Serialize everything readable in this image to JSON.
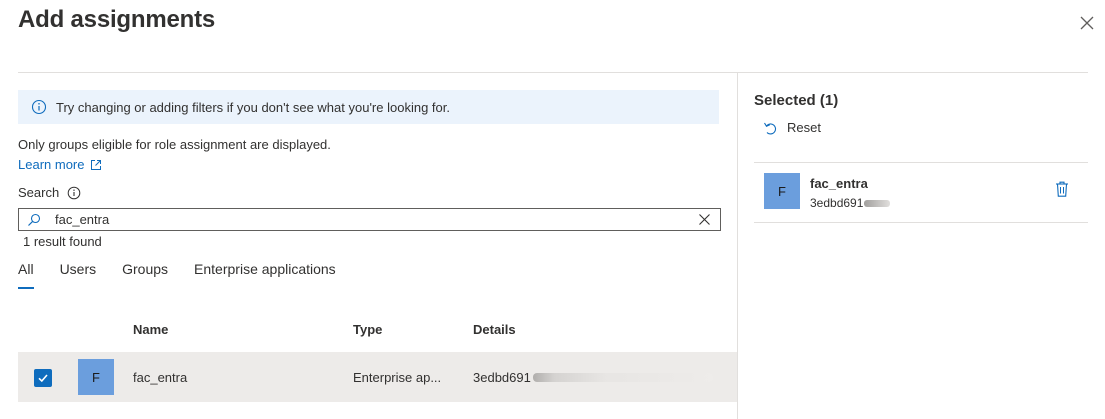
{
  "dialog": {
    "title": "Add assignments",
    "close_icon": "close-icon"
  },
  "info_bar": {
    "icon": "info-icon",
    "text": "Try changing or adding filters if you don't see what you're looking for."
  },
  "eligibility_note": "Only groups eligible for role assignment are displayed.",
  "learn_more": {
    "label": "Learn more",
    "icon": "external-link-icon"
  },
  "search": {
    "label": "Search",
    "value": "fac_entra",
    "placeholder": "",
    "result_count": "1 result found"
  },
  "tabs": [
    {
      "label": "All",
      "active": true
    },
    {
      "label": "Users",
      "active": false
    },
    {
      "label": "Groups",
      "active": false
    },
    {
      "label": "Enterprise applications",
      "active": false
    }
  ],
  "table": {
    "columns": {
      "name": "Name",
      "type": "Type",
      "details": "Details"
    },
    "rows": [
      {
        "checked": true,
        "avatar": "F",
        "name": "fac_entra",
        "type": "Enterprise ap...",
        "details": "3edbd691"
      }
    ]
  },
  "selected": {
    "title": "Selected (1)",
    "reset_label": "Reset",
    "items": [
      {
        "avatar": "F",
        "name": "fac_entra",
        "id": "3edbd691"
      }
    ]
  },
  "colors": {
    "accent": "#0f6cbd",
    "info_bg": "#ebf3fc",
    "avatar_bg": "#6b9edd",
    "row_selected_bg": "#edebe9"
  }
}
